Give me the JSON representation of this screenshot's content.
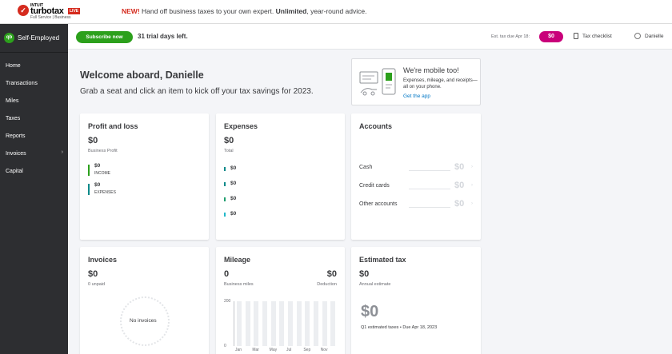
{
  "banner": {
    "logo": {
      "check": "✓",
      "intuit": "INTUIT",
      "brand": "turbotax",
      "live": "LIVE",
      "sub": "Full Service | Business"
    },
    "promo_new": "NEW!",
    "promo_a": " Hand off business taxes to your own expert. ",
    "promo_b": "Unlimited",
    "promo_c": ", year-round advice."
  },
  "sidebar": {
    "brand_icon": "qb",
    "brand": "Self-Employed",
    "items": [
      {
        "label": "Home"
      },
      {
        "label": "Transactions"
      },
      {
        "label": "Miles"
      },
      {
        "label": "Taxes"
      },
      {
        "label": "Reports"
      },
      {
        "label": "Invoices",
        "chevron": "›"
      },
      {
        "label": "Capital"
      }
    ]
  },
  "topbar": {
    "subscribe": "Subscribe now",
    "trial": "31 trial days left.",
    "est_label": "Est. tax due Apr 18:",
    "est_value": "$0",
    "checklist": "Tax checklist",
    "user": "Danielle"
  },
  "welcome": {
    "title": "Welcome aboard, Danielle",
    "subtitle": "Grab a seat and click an item to kick off your tax savings for 2023."
  },
  "mobile": {
    "title": "We're mobile too!",
    "body": "Expenses, mileage, and receipts—all on your phone.",
    "link": "Get the app"
  },
  "cards": {
    "pnl": {
      "title": "Profit and loss",
      "value": "$0",
      "caption": "Business Profit",
      "income_value": "$0",
      "income_label": "INCOME",
      "expenses_value": "$0",
      "expenses_label": "EXPENSES"
    },
    "expenses": {
      "title": "Expenses",
      "value": "$0",
      "caption": "Total",
      "rows": [
        "$0",
        "$0",
        "$0",
        "$0"
      ]
    },
    "accounts": {
      "title": "Accounts",
      "rows": [
        {
          "name": "Cash",
          "value": "$0",
          "chevron": "›"
        },
        {
          "name": "Credit cards",
          "value": "$0",
          "chevron": "›"
        },
        {
          "name": "Other accounts",
          "value": "$0",
          "chevron": "›"
        }
      ]
    },
    "invoices": {
      "title": "Invoices",
      "value": "$0",
      "caption": "0 unpaid",
      "empty": "No invoices"
    },
    "mileage": {
      "title": "Mileage",
      "miles_value": "0",
      "miles_caption": "Business miles",
      "deduction_value": "$0",
      "deduction_caption": "Deduction"
    },
    "estimated": {
      "title": "Estimated tax",
      "value": "$0",
      "caption": "Annual estimate",
      "big": "$0",
      "note": "Q1 estimated taxes • Due Apr 18, 2023"
    }
  },
  "colors": {
    "green": "#2ca01c",
    "teal": "#0d8a8a",
    "cyan": "#21b8c9",
    "magenta": "#c9007a",
    "link": "#0077c5"
  },
  "chart_data": {
    "type": "bar",
    "title": "",
    "xlabel": "",
    "ylabel": "",
    "ylim": [
      0,
      200
    ],
    "yticks": [
      "200",
      "0"
    ],
    "x_tick_labels": [
      "Jan",
      "Mar",
      "May",
      "Jul",
      "Sep",
      "Nov"
    ],
    "bar_count": 12,
    "values": [
      200,
      200,
      200,
      200,
      200,
      200,
      200,
      200,
      200,
      200,
      200,
      200
    ]
  }
}
